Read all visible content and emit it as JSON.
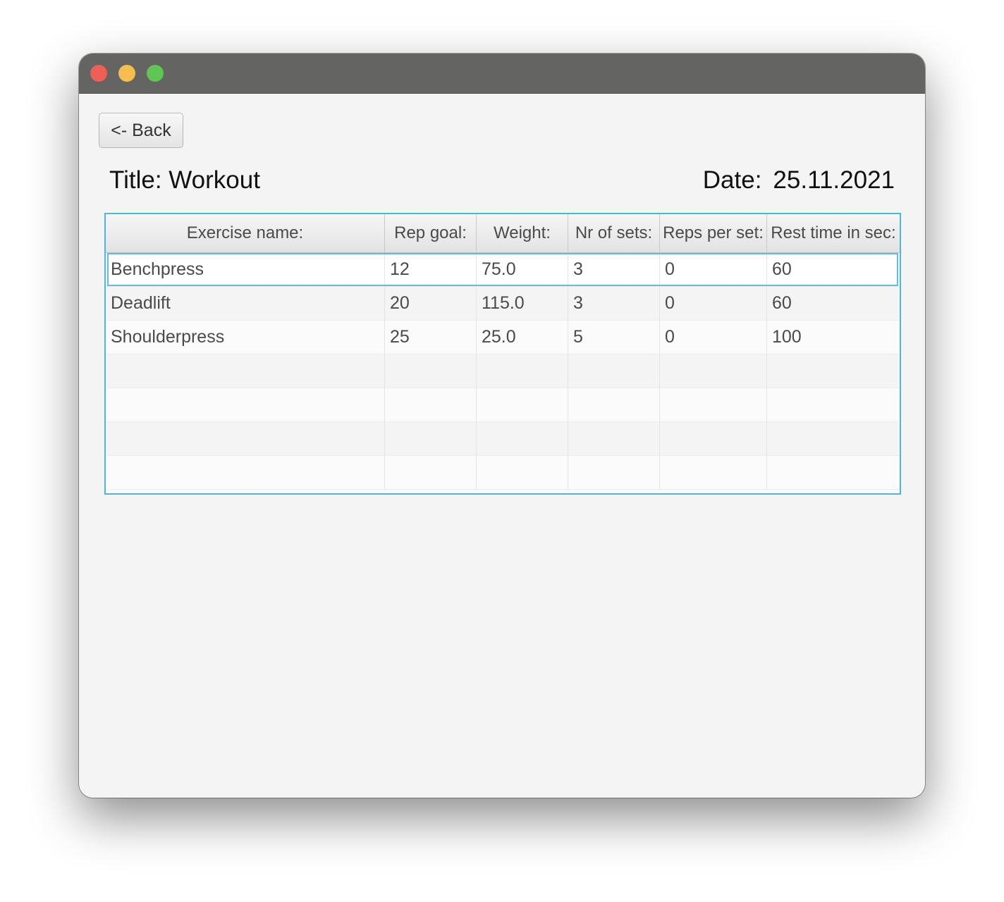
{
  "back_button": {
    "label": "<- Back"
  },
  "workout": {
    "title_prefix": "Title:",
    "title": "Workout",
    "date_prefix": "Date:",
    "date": "25.11.2021"
  },
  "table": {
    "columns": [
      "Exercise name:",
      "Rep goal:",
      "Weight:",
      "Nr of sets:",
      "Reps per set:",
      "Rest time in sec:"
    ],
    "rows": [
      [
        "Benchpress",
        "12",
        "75.0",
        "3",
        "0",
        "60"
      ],
      [
        "Deadlift",
        "20",
        "115.0",
        "3",
        "0",
        "60"
      ],
      [
        "Shoulderpress",
        "25",
        "25.0",
        "5",
        "0",
        "100"
      ]
    ],
    "selected_row": 0
  },
  "colors": {
    "titlebar": "#646462",
    "close": "#ee5f56",
    "minimize": "#f6bd4f",
    "maximize": "#5fc553",
    "focus_border": "#4fb5dc",
    "window_bg": "#f4f4f4"
  }
}
